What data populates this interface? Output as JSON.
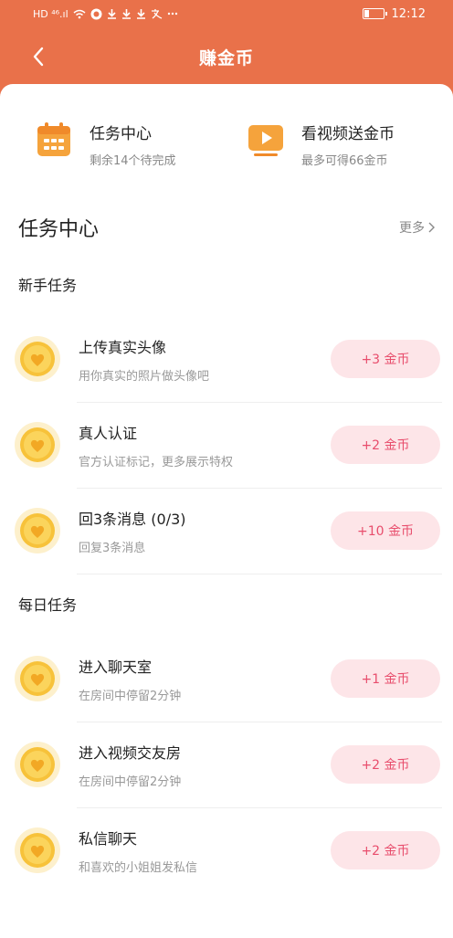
{
  "status_bar": {
    "left_badges": "HD ⁴⁶.ıl",
    "time": "12:12"
  },
  "header": {
    "title": "赚金币"
  },
  "top_cards": [
    {
      "title": "任务中心",
      "subtitle": "剩余14个待完成",
      "icon": "calendar-icon",
      "color": "#f5a33c"
    },
    {
      "title": "看视频送金币",
      "subtitle": "最多可得66金币",
      "icon": "video-play-icon",
      "color": "#f5a33c"
    }
  ],
  "section": {
    "title": "任务中心",
    "more_label": "更多"
  },
  "groups": [
    {
      "title": "新手任务",
      "tasks": [
        {
          "name": "上传真实头像",
          "desc": "用你真实的照片做头像吧",
          "reward": "+3 金币"
        },
        {
          "name": "真人认证",
          "desc": "官方认证标记，更多展示特权",
          "reward": "+2 金币"
        },
        {
          "name": "回3条消息 (0/3)",
          "desc": "回复3条消息",
          "reward": "+10 金币"
        }
      ]
    },
    {
      "title": "每日任务",
      "tasks": [
        {
          "name": "进入聊天室",
          "desc": "在房间中停留2分钟",
          "reward": "+1 金币"
        },
        {
          "name": "进入视频交友房",
          "desc": "在房间中停留2分钟",
          "reward": "+2 金币"
        },
        {
          "name": "私信聊天",
          "desc": "和喜欢的小姐姐发私信",
          "reward": "+2 金币"
        }
      ]
    }
  ],
  "colors": {
    "header_bg": "#e9714a",
    "reward_bg": "#fde5e8",
    "reward_text": "#e84d6c",
    "coin": "#f7c23a"
  }
}
